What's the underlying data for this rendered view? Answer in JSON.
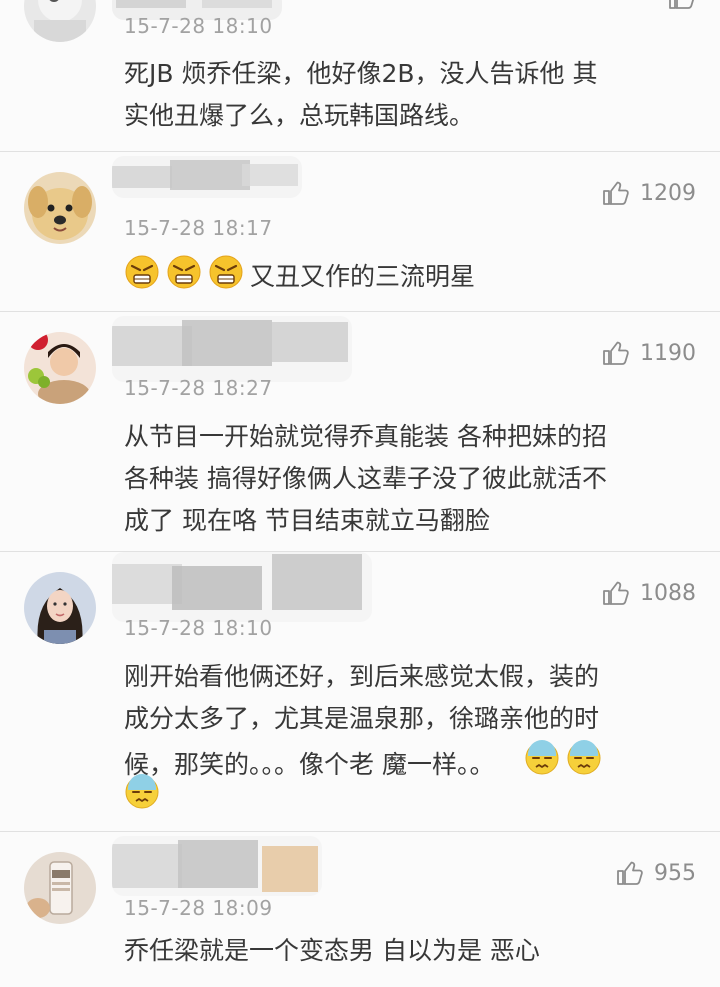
{
  "comments": [
    {
      "time": "15-7-28 18:10",
      "likes": "",
      "text_lines": [
        "死JB 烦乔任梁，他好像2B，没人告诉他 其",
        "实他丑爆了么，总玩韩国路线。"
      ]
    },
    {
      "time": "15-7-28 18:17",
      "likes": "1209",
      "text": "又丑又作的三流明星",
      "emojis": [
        "angry-face-icon",
        "angry-face-icon",
        "angry-face-icon"
      ]
    },
    {
      "time": "15-7-28 18:27",
      "likes": "1190",
      "text_lines": [
        "从节目一开始就觉得乔真能装 各种把妹的招",
        "各种装 搞得好像俩人这辈子没了彼此就活不",
        "成了  现在咯 节目结束就立马翻脸"
      ]
    },
    {
      "time": "15-7-28 18:10",
      "likes": "1088",
      "text_lines": [
        "刚开始看他俩还好，到后来感觉太假，装的",
        "成分太多了，尤其是温泉那，徐璐亲他的时",
        "候，那笑的。。。像个老 魔一样。。"
      ],
      "emojis": [
        "sweat-face-icon",
        "sweat-face-icon",
        "sweat-face-icon"
      ]
    },
    {
      "time": "15-7-28 18:09",
      "likes": "955",
      "text_lines": [
        "乔任梁就是一个变态男 自以为是 恶心"
      ]
    }
  ],
  "colors": {
    "background": "#fbfbfb",
    "divider": "#e1e1e1",
    "time": "#a2a2a2",
    "text": "#383838",
    "like": "#8c8c8c"
  }
}
